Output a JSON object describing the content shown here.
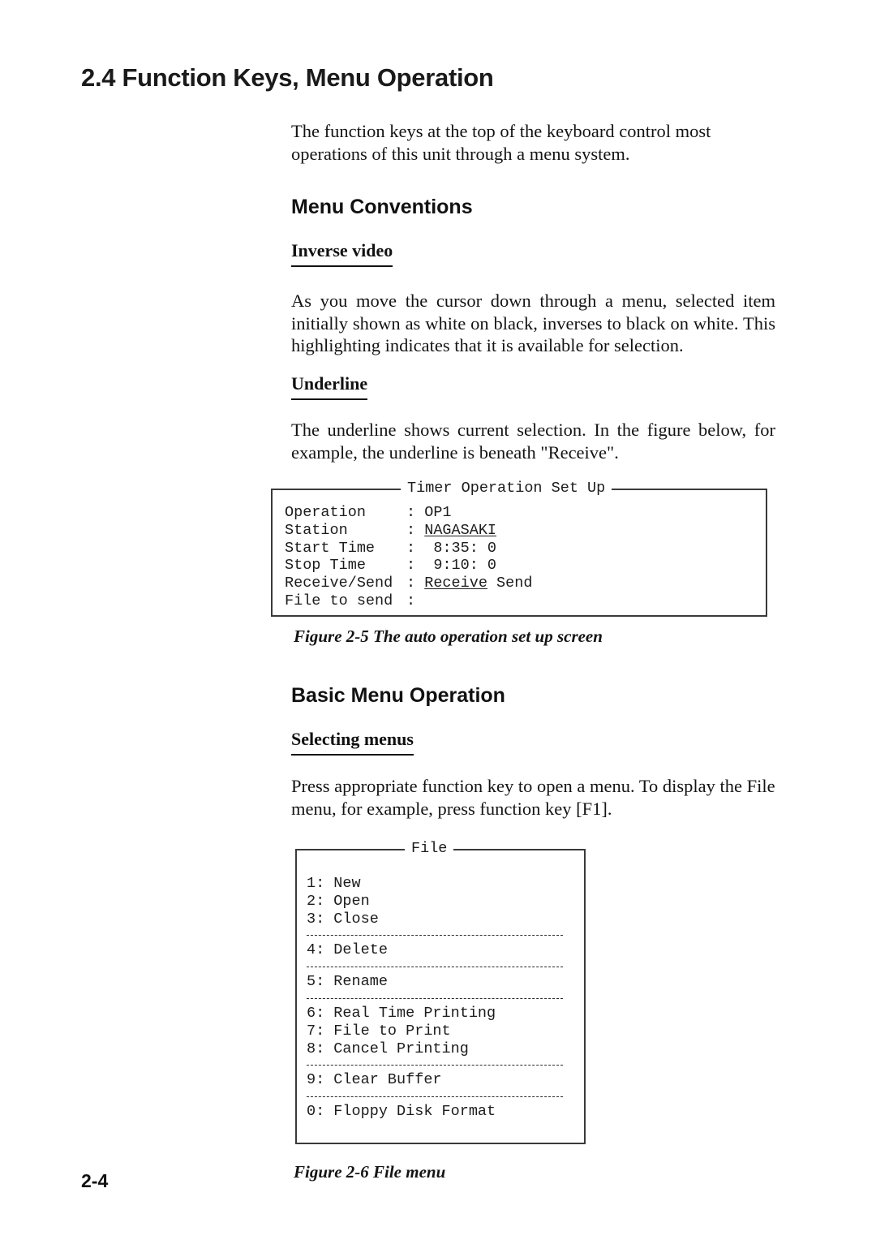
{
  "page": {
    "number": "2-4",
    "section_title": "2.4 Function Keys, Menu Operation"
  },
  "intro": {
    "paragraph": "The function keys at the top of the keyboard control most operations of this unit through a menu system."
  },
  "menu_conventions": {
    "heading": "Menu Conventions",
    "inverse_video": {
      "heading": "Inverse video",
      "paragraph": "As you move the cursor down through a menu, selected item initially shown as white on black, inverses to black on white. This highlighting indicates that it is available for selection."
    },
    "underline": {
      "heading": "Underline",
      "paragraph": "The underline shows current selection. In the figure below, for example, the underline is beneath \"Receive\"."
    }
  },
  "figure_2_5": {
    "caption": "Figure 2-5 The auto operation set up screen",
    "screen": {
      "title": "Timer Operation Set Up",
      "rows": [
        {
          "label": "Operation",
          "colon": ":",
          "value": "OP1",
          "underlined": false,
          "extra": ""
        },
        {
          "label": "Station",
          "colon": ":",
          "value": "NAGASAKI",
          "underlined": true,
          "extra": ""
        },
        {
          "label": "Start Time",
          "colon": ":",
          "value": " 8:35: 0",
          "underlined": false,
          "extra": ""
        },
        {
          "label": "Stop Time",
          "colon": ":",
          "value": " 9:10: 0",
          "underlined": false,
          "extra": ""
        },
        {
          "label": "Receive/Send",
          "colon": ":",
          "value": "Receive",
          "underlined": true,
          "extra": " Send"
        },
        {
          "label": "File to send",
          "colon": ":",
          "value": "",
          "underlined": false,
          "extra": ""
        }
      ]
    }
  },
  "basic_menu_operation": {
    "heading": "Basic Menu Operation",
    "selecting_menus": {
      "heading": "Selecting menus",
      "paragraph": "Press appropriate function key to open a menu. To display the File menu, for example, press function key [F1]."
    }
  },
  "figure_2_6": {
    "caption": "Figure 2-6 File menu",
    "screen": {
      "title": "File",
      "items": [
        {
          "text": "1: New",
          "separator_after": false
        },
        {
          "text": "2: Open",
          "separator_after": false
        },
        {
          "text": "3: Close",
          "separator_after": true
        },
        {
          "text": "4: Delete",
          "separator_after": true
        },
        {
          "text": "5: Rename",
          "separator_after": true
        },
        {
          "text": "6: Real Time Printing",
          "separator_after": false
        },
        {
          "text": "7: File to Print",
          "separator_after": false
        },
        {
          "text": "8: Cancel Printing",
          "separator_after": true
        },
        {
          "text": "9: Clear Buffer",
          "separator_after": true
        },
        {
          "text": "0: Floppy Disk Format",
          "separator_after": false
        }
      ]
    }
  },
  "colors": {
    "text": "#141414",
    "border": "#3a3a3a",
    "background": "#ffffff"
  }
}
